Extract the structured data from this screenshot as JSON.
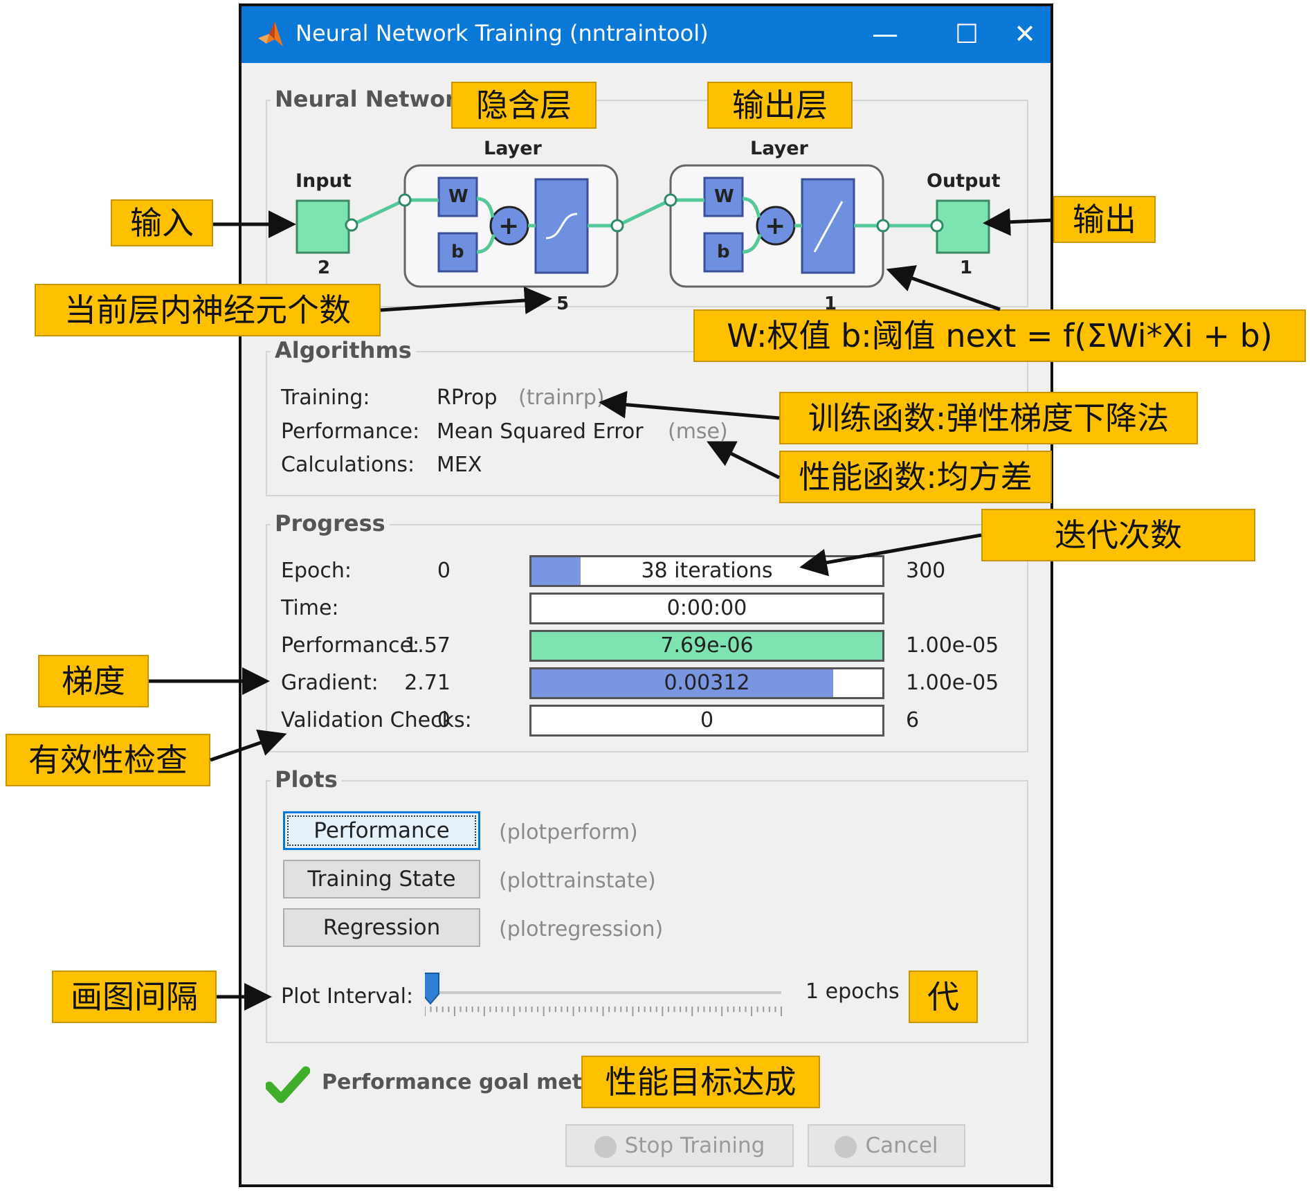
{
  "window": {
    "title": "Neural Network Training (nntraintool)",
    "minimize": "—",
    "maximize": "☐",
    "close": "✕"
  },
  "network": {
    "group_title": "Neural Network",
    "input_label": "Input",
    "input_size": "2",
    "hidden_label": "Layer",
    "hidden_size": "5",
    "output_layer_label": "Layer",
    "output_layer_size": "1",
    "output_label": "Output",
    "output_size": "1",
    "w": "W",
    "b": "b",
    "plus": "+"
  },
  "algorithms": {
    "group_title": "Algorithms",
    "rows": [
      {
        "label": "Training:",
        "value": "RProp",
        "fn": "(trainrp)"
      },
      {
        "label": "Performance:",
        "value": "Mean Squared Error",
        "fn": "(mse)"
      },
      {
        "label": "Calculations:",
        "value": "MEX",
        "fn": ""
      }
    ]
  },
  "progress": {
    "group_title": "Progress",
    "rows": [
      {
        "label": "Epoch:",
        "start": "0",
        "current": "38 iterations",
        "end": "300",
        "fill": 0.14,
        "color": "#7b96e0"
      },
      {
        "label": "Time:",
        "start": "",
        "current": "0:00:00",
        "end": "",
        "fill": 0,
        "color": "#7b96e0"
      },
      {
        "label": "Performance:",
        "start": "1.57",
        "current": "7.69e-06",
        "end": "1.00e-05",
        "fill": 1.0,
        "color": "#7de3b0"
      },
      {
        "label": "Gradient:",
        "start": "2.71",
        "current": "0.00312",
        "end": "1.00e-05",
        "fill": 0.86,
        "color": "#7b96e0"
      },
      {
        "label": "Validation Checks:",
        "start": "0",
        "current": "0",
        "end": "6",
        "fill": 0,
        "color": "#7b96e0"
      }
    ]
  },
  "plots": {
    "group_title": "Plots",
    "buttons": [
      {
        "label": "Performance",
        "fn": "(plotperform)"
      },
      {
        "label": "Training State",
        "fn": "(plottrainstate)"
      },
      {
        "label": "Regression",
        "fn": "(plotregression)"
      }
    ],
    "interval_label": "Plot Interval:",
    "interval_value": "1 epochs",
    "interval_fraction": 0
  },
  "status": {
    "message": "Performance goal met.",
    "stop_button": "Stop Training",
    "cancel_button": "Cancel"
  },
  "annotations": {
    "hidden_layer": "隐含层",
    "output_layer": "输出层",
    "input": "输入",
    "output": "输出",
    "neuron_count": "当前层内神经元个数",
    "formula": "W:权值 b:阈值 next = f(ΣWi*Xi + b)",
    "training_fn": "训练函数:弹性梯度下降法",
    "performance_fn": "性能函数:均方差",
    "iterations": "迭代次数",
    "gradient": "梯度",
    "validation": "有效性检查",
    "plot_interval": "画图间隔",
    "epoch": "代",
    "goal_met": "性能目标达成"
  },
  "colors": {
    "titlebar": "#0a78d7",
    "annotation": "#ffc000",
    "node_green": "#7de3b0",
    "node_blue": "#6f8fe0",
    "check_green": "#3fae2a"
  }
}
